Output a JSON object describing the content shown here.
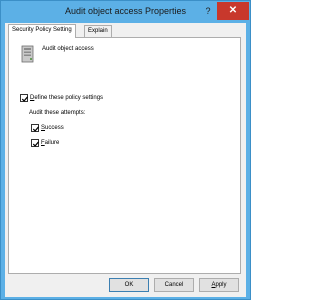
{
  "window": {
    "title": "Audit object access Properties",
    "help_glyph": "?",
    "close_glyph": "✕"
  },
  "tabs": [
    {
      "label": "Security Policy Setting",
      "active": true
    },
    {
      "label": "Explain",
      "active": false
    }
  ],
  "policy": {
    "name": "Audit object access",
    "icon": "policy-server-icon"
  },
  "settings": {
    "define_label_underlined": "D",
    "define_label_rest": "efine these policy settings",
    "define_checked": true,
    "audit_attempts_label": "Audit these attempts:",
    "success_label_underlined": "S",
    "success_label_rest": "uccess",
    "success_checked": true,
    "failure_label_underlined": "F",
    "failure_label_rest": "ailure",
    "failure_checked": true
  },
  "buttons": {
    "ok": "OK",
    "cancel": "Cancel",
    "apply_underlined": "A",
    "apply_rest": "pply"
  },
  "colors": {
    "title_bar": "#5cb0e6",
    "close_button": "#c8382c",
    "dialog_bg": "#f0f0f0"
  }
}
